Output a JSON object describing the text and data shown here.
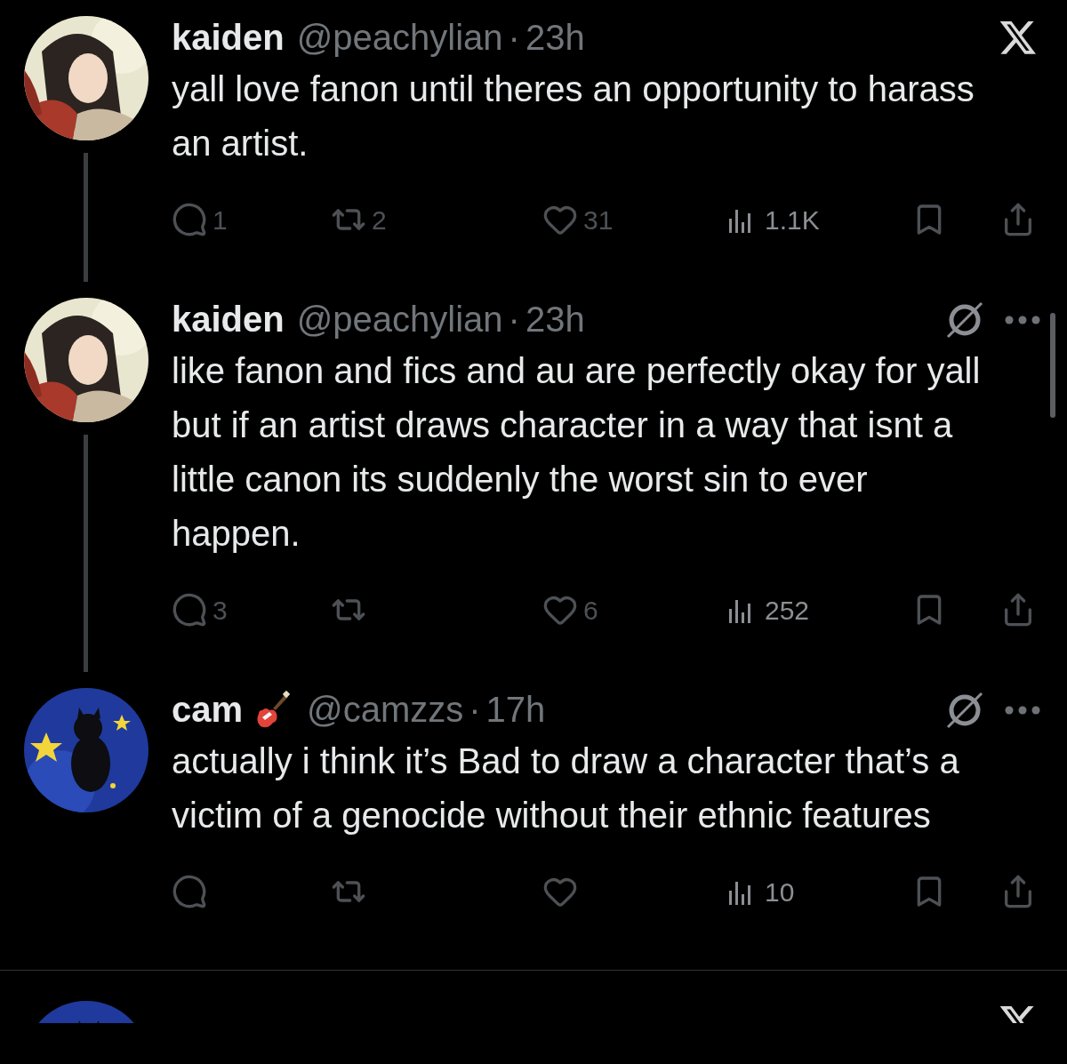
{
  "tweets": [
    {
      "name": "kaiden",
      "handle": "@peachylian",
      "separator": "·",
      "time": "23h",
      "corner": {
        "kind": "logo"
      },
      "thread_line": true,
      "text": "yall love fanon until theres an opportunity to harass an artist.",
      "replies": "1",
      "reposts": "2",
      "likes": "31",
      "views": "1.1K"
    },
    {
      "name": "kaiden",
      "handle": "@peachylian",
      "separator": "·",
      "time": "23h",
      "corner": {
        "kind": "menu"
      },
      "thread_line": true,
      "text": "like fanon and fics and au are perfectly okay for yall but if an artist draws character in a way that isnt a little canon its suddenly the worst sin to ever happen.",
      "replies": "3",
      "likes": "6",
      "views": "252"
    },
    {
      "name": "cam",
      "name_emoji": {
        "kind": "guitar"
      },
      "handle": "@camzzs",
      "separator": "·",
      "time": "17h",
      "corner": {
        "kind": "menu"
      },
      "thread_line": false,
      "text": "actually i think it’s Bad to draw a character that’s a victim of a genocide without their ethnic features",
      "views": "10"
    }
  ],
  "next_row": {
    "corner": {
      "kind": "logo"
    }
  }
}
